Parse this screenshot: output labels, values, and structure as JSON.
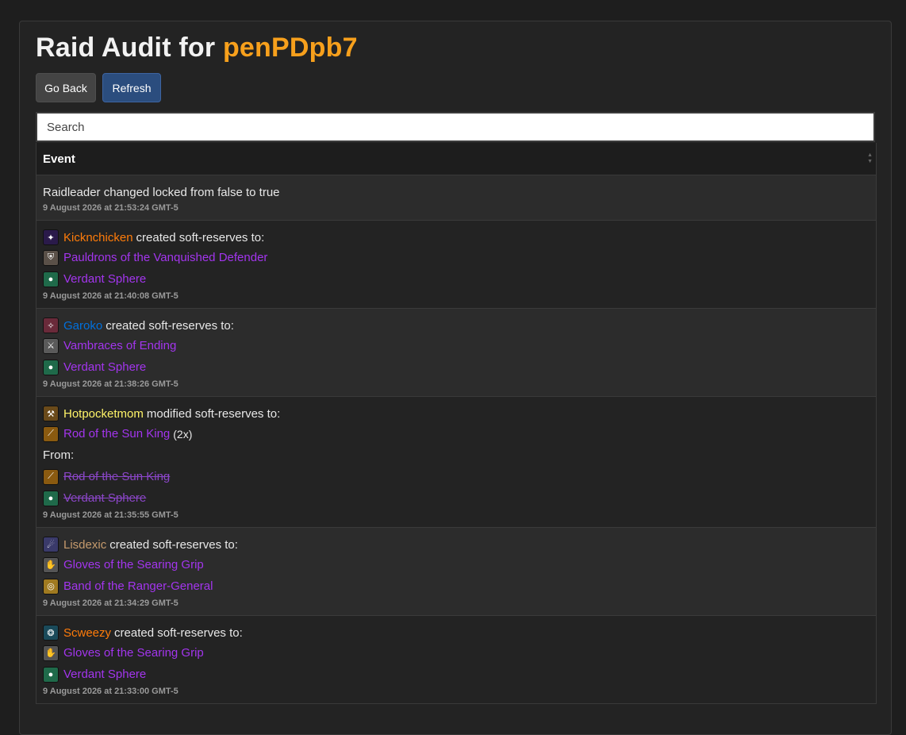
{
  "header": {
    "title_prefix": "Raid Audit for",
    "raid_id": "penPDpb7"
  },
  "buttons": {
    "back": "Go Back",
    "refresh": "Refresh"
  },
  "search": {
    "placeholder": "Search"
  },
  "table": {
    "column": "Event"
  },
  "events": {
    "e0": {
      "text": "Raidleader changed locked from false to true",
      "time": "9 August 2026 at 21:53:24 GMT-5"
    },
    "e1": {
      "player": "Kicknchicken",
      "action": "created soft-reserves to:",
      "items": [
        "Pauldrons of the Vanquished Defender",
        "Verdant Sphere"
      ],
      "time": "9 August 2026 at 21:40:08 GMT-5"
    },
    "e2": {
      "player": "Garoko",
      "action": "created soft-reserves to:",
      "items": [
        "Vambraces of Ending",
        "Verdant Sphere"
      ],
      "time": "9 August 2026 at 21:38:26 GMT-5"
    },
    "e3": {
      "player": "Hotpocketmom",
      "action": "modified soft-reserves to:",
      "items": [
        "Rod of the Sun King"
      ],
      "count": "(2x)",
      "from_label": "From:",
      "from_items": [
        "Rod of the Sun King",
        "Verdant Sphere"
      ],
      "time": "9 August 2026 at 21:35:55 GMT-5"
    },
    "e4": {
      "player": "Lisdexic",
      "action": "created soft-reserves to:",
      "items": [
        "Gloves of the Searing Grip",
        "Band of the Ranger-General"
      ],
      "time": "9 August 2026 at 21:34:29 GMT-5"
    },
    "e5": {
      "player": "Scweezy",
      "action": "created soft-reserves to:",
      "items": [
        "Gloves of the Searing Grip",
        "Verdant Sphere"
      ],
      "time": "9 August 2026 at 21:33:00 GMT-5"
    }
  },
  "colors": {
    "accent": "#f7a01c",
    "epic_item": "#a335ee",
    "class_rogue_like": "#ff7c0a",
    "class_shaman_like": "#0070dd",
    "class_rogue_yellow": "#fff468",
    "class_warrior_tan": "#c69b6d"
  }
}
